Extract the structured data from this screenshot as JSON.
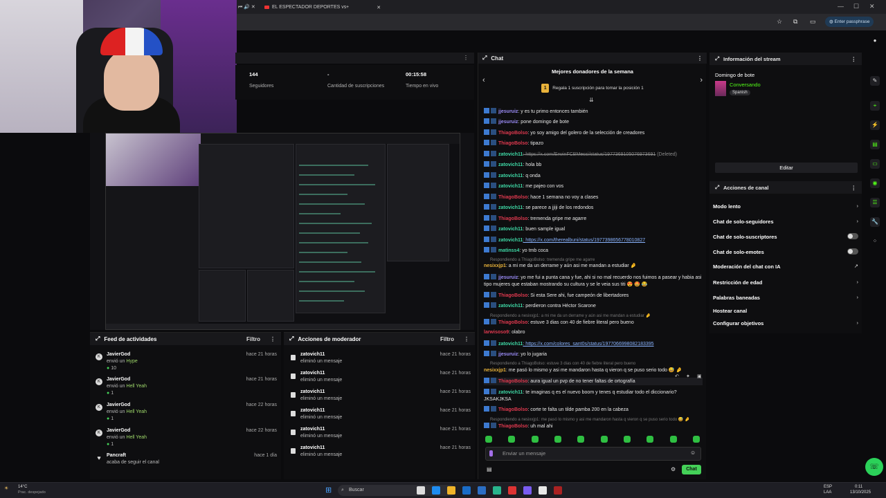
{
  "browser": {
    "tab_title": "EL ESPECTADOR DEPORTES vs",
    "passphrase": "Enter passphrase"
  },
  "stats": [
    {
      "value": "144",
      "label": "Seguidores"
    },
    {
      "value": "-",
      "label": "Cantidad de suscripciones"
    },
    {
      "value": "00:15:58",
      "label": "Tiempo en vivo"
    }
  ],
  "chat": {
    "title": "Chat",
    "donors_title": "Mejores donadores de la semana",
    "donors_badge": "1",
    "donors_sub": "Regala 1 suscripción para tomar la posición 1",
    "input_placeholder": "Enviar un mensaje",
    "send_label": "Chat",
    "messages": [
      {
        "user": "jjesuruiz",
        "color": "#9b8cf7",
        "text": ": y es tu primo entonces también"
      },
      {
        "user": "jjesuruiz",
        "color": "#9b8cf7",
        "text": ": pone domingo de bote"
      },
      {
        "user": "ThiagoBolso",
        "color": "#e0394f",
        "text": ": yo soy amigo del golero de la selección de creadores"
      },
      {
        "user": "ThiagoBolso",
        "color": "#e0394f",
        "text": ": tipazo"
      },
      {
        "user": "zatovich11",
        "color": "#3fd9a6",
        "text": ": https://x.com/ErwinFCBMessi/status/1977369105076973691",
        "deleted": "(Deleted)"
      },
      {
        "user": "zatovich11",
        "color": "#3fd9a6",
        "text": ": hola bb"
      },
      {
        "user": "zatovich11",
        "color": "#3fd9a6",
        "text": ": q onda"
      },
      {
        "user": "zatovich11",
        "color": "#3fd9a6",
        "text": ": me pajeo con vos"
      },
      {
        "user": "ThiagoBolso",
        "color": "#e0394f",
        "text": ": hace 1 semana no voy a clases"
      },
      {
        "user": "zatovich11",
        "color": "#3fd9a6",
        "text": ": se parece a jjiji de los redondos"
      },
      {
        "user": "ThiagoBolso",
        "color": "#e0394f",
        "text": ": tremenda gripe me agarre"
      },
      {
        "user": "zatovich11",
        "color": "#3fd9a6",
        "text": ": buen sample igual"
      },
      {
        "user": "zatovich11",
        "color": "#3fd9a6",
        "text": ": https://x.com/therealbuni/status/1977398656778010827"
      },
      {
        "user": "matinss4",
        "color": "#3fd9a6",
        "text": ": yo tmb coca"
      }
    ],
    "reply1": "Respondiendo a ThiagoBolso: tremenda gripe me agarre",
    "msg_nesxi1": {
      "user": "nesixxjp1",
      "text": ": a mi me da un derrame y aún asi me mandan a estudiar 🤌"
    },
    "msg_jjes_long": {
      "user": "jjesuruiz",
      "text": ": yo me fui a punta cana y fue, ahi si no mal recuerdo nos fuimos a pasear y habia asi tipo mujeres que estaban mostrando su cultura y se le veia sus titi 😍 🤩 😂"
    },
    "msg_thiago_sere": {
      "user": "ThiagoBolso",
      "text": ": Si esta Sere ahi, fue campeón de libertadores"
    },
    "msg_zato_hector": {
      "user": "zatovich11",
      "text": ": perdieron contra Héctor Scarone"
    },
    "reply2": "Respondiendo a nesixxjp1: a mi me da un derrame y aún asi me mandan a estudiar 🤌",
    "msg_thiago_fiebre": {
      "user": "ThiagoBolso",
      "text": ": estuve 3 dias con 40 de fiebre literal pero bueno"
    },
    "msg_larwisoso": {
      "user": "larwisoso9",
      "text": ": olabro"
    },
    "msg_zato_colores": {
      "user": "zatovich11",
      "text": ": https://x.com/colores_sant0s/status/1977066998082183395"
    },
    "msg_jjes_jugaria": {
      "user": "jjesuruiz",
      "text": ": yo lo jugaria"
    },
    "reply3": "Respondiendo a ThiagoBolso: estuve 3 dias con 40 de fiebre literal pero bueno",
    "msg_nesxi2": {
      "user": "nesixxjp1",
      "text": ": me pasó lo mismo y asi me mandaron hasta q vieron q se puso serio todo 😅 🤌"
    },
    "msg_thiago_pvp": {
      "user": "ThiagoBolso",
      "text": ": aura igual un pvp de no tener faltas de ortografía"
    },
    "msg_zato_imaginas": {
      "user": "zatovich11",
      "text": ": te imaginas q es el nuevo boom y tenes q estudiar todo el diccionario? JKSAKJKSA"
    },
    "msg_thiago_tilde": {
      "user": "ThiagoBolso",
      "text": ": corte te falta un tilde pamba 200 en la cabeza"
    },
    "reply4": "Respondiendo a nesixxjp1: me pasó lo mismo y asi me mandaron hasta q vieron q se puso serio todo 😅 🤌",
    "msg_thiago_mal": {
      "user": "ThiagoBolso",
      "text": ": uh mal ahi"
    }
  },
  "stream_info": {
    "title": "Información del stream",
    "stream_title": "Domingo de bote",
    "category": "Conversando",
    "language": "Spanish",
    "edit_label": "Editar"
  },
  "channel_actions": {
    "title": "Acciones de canal",
    "items": [
      {
        "label": "Modo lento",
        "kind": "chevron"
      },
      {
        "label": "Chat de solo-seguidores",
        "kind": "chevron"
      },
      {
        "label": "Chat de solo-suscriptores",
        "kind": "toggle"
      },
      {
        "label": "Chat de solo-emotes",
        "kind": "toggle"
      },
      {
        "label": "Moderación del chat con IA",
        "kind": "external"
      },
      {
        "label": "Restricción de edad",
        "kind": "chevron"
      },
      {
        "label": "Palabras baneadas",
        "kind": "chevron"
      },
      {
        "label": "Hostear canal",
        "kind": "none"
      },
      {
        "label": "Configurar objetivos",
        "kind": "chevron"
      }
    ]
  },
  "activity_feed": {
    "title": "Feed de actividades",
    "filter": "Filtro",
    "items": [
      {
        "user": "JavierGod",
        "action": "envió un",
        "item": "Hype",
        "amount": "10",
        "time": "hace 21 horas"
      },
      {
        "user": "JavierGod",
        "action": "envió un",
        "item": "Hell Yeah",
        "amount": "1",
        "time": "hace 21 horas"
      },
      {
        "user": "JavierGod",
        "action": "envió un",
        "item": "Hell Yeah",
        "amount": "1",
        "time": "hace 22 horas"
      },
      {
        "user": "JavierGod",
        "action": "envió un",
        "item": "Hell Yeah",
        "amount": "1",
        "time": "hace 22 horas"
      },
      {
        "user": "Pancraft",
        "action": "acaba de seguir el canal",
        "item": "",
        "amount": "",
        "time": "hace 1 día"
      }
    ]
  },
  "mod_actions": {
    "title": "Acciones de moderador",
    "filter": "Filtro",
    "items": [
      {
        "user": "zatovich11",
        "action": "eliminó un mensaje",
        "time": "hace 21 horas"
      },
      {
        "user": "zatovich11",
        "action": "eliminó un mensaje",
        "time": "hace 21 horas"
      },
      {
        "user": "zatovich11",
        "action": "eliminó un mensaje",
        "time": "hace 21 horas"
      },
      {
        "user": "zatovich11",
        "action": "eliminó un mensaje",
        "time": "hace 21 horas"
      },
      {
        "user": "zatovich11",
        "action": "eliminó un mensaje",
        "time": "hace 21 horas"
      },
      {
        "user": "zatovich11",
        "action": "eliminó un mensaje",
        "time": "hace 21 horas"
      }
    ]
  },
  "taskbar": {
    "weather": "14°C",
    "weather_desc": "Prac. despejado",
    "search": "Buscar",
    "lang": "ESP",
    "lang2": "LAA",
    "time": "0:11",
    "date": "13/10/2025"
  }
}
